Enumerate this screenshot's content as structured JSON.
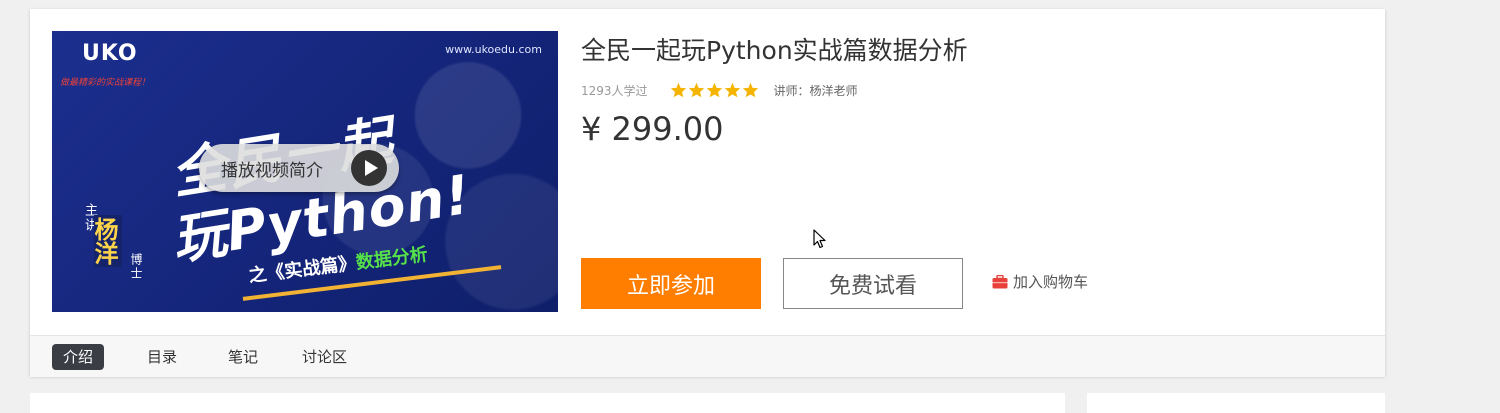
{
  "course": {
    "title": "全民一起玩Python实战篇数据分析",
    "learners": "1293人学过",
    "rating_stars": 5,
    "teacher": "讲师：杨洋老师",
    "price": "¥ 299.00"
  },
  "cover": {
    "brand": "UKO",
    "slogan": "做最精彩的实战课程！",
    "site": "www.ukoedu.com",
    "headline_1": "全民一起",
    "headline_2": "玩Python!",
    "subtitle_prefix": "之《实战篇》",
    "subtitle_highlight": "数据分析",
    "teacher_prefix": "主讲",
    "teacher_name": "杨洋",
    "teacher_suffix": "博士",
    "play_label": "播放视频简介"
  },
  "actions": {
    "join": "立即参加",
    "trial": "免费试看",
    "cart": "加入购物车"
  },
  "tabs": [
    {
      "label": "介绍",
      "active": true
    },
    {
      "label": "目录",
      "active": false
    },
    {
      "label": "笔记",
      "active": false
    },
    {
      "label": "讨论区",
      "active": false
    }
  ],
  "colors": {
    "accent": "#ff7e00",
    "star": "#f5b400",
    "cover_bg": "#1c2f8e",
    "tab_active_bg": "#3b3d45",
    "cart_icon": "#e8413a"
  },
  "icons": {
    "play": "play-icon",
    "star": "star-icon",
    "cart": "briefcase-cart-icon",
    "cursor": "mouse-pointer-icon"
  }
}
